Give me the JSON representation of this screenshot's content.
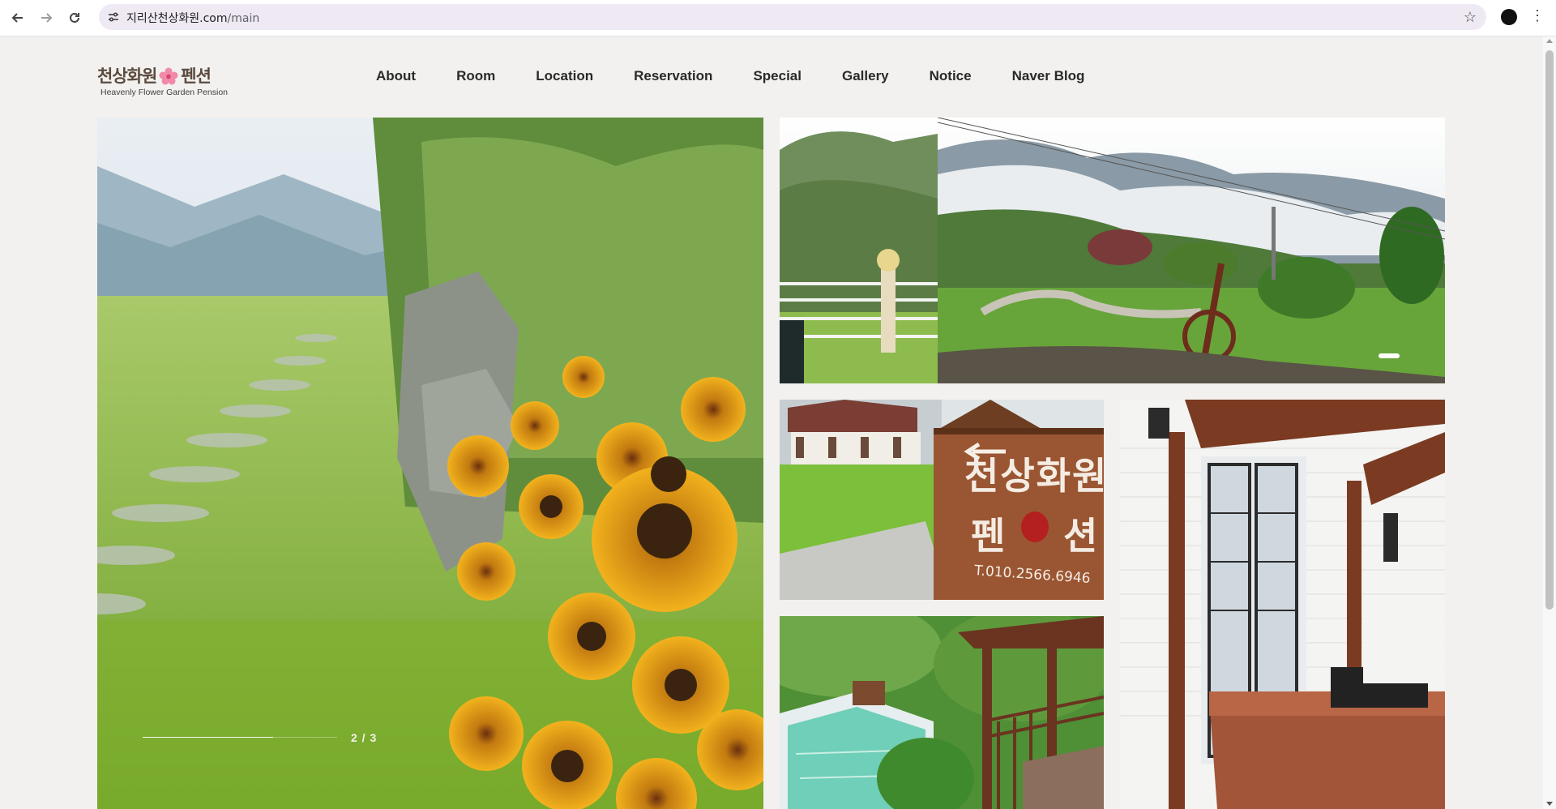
{
  "browser": {
    "url_host": "지리산천상화원.com",
    "url_path": "/main",
    "back_icon": "arrow-left-icon",
    "forward_icon": "arrow-right-icon",
    "reload_icon": "reload-icon",
    "bookmark_icon": "star-icon"
  },
  "site": {
    "logo_part1": "천상화원",
    "logo_part2": "펜션",
    "logo_tagline": "Heavenly Flower Garden Pension",
    "menu": [
      "About",
      "Room",
      "Location",
      "Reservation",
      "Special",
      "Gallery",
      "Notice",
      "Naver Blog"
    ]
  },
  "hero_slider": {
    "counter": "2 / 3",
    "current": 2,
    "total": 3
  },
  "gallery": {
    "sign_line1": "천상화원",
    "sign_line2_left": "펜",
    "sign_line2_right": "션",
    "sign_phone": "T.010.2566.6946"
  },
  "colors": {
    "page_bg": "#f2f1ef",
    "menu_text": "#2a2a2a",
    "logo_brown": "#5a4a3e"
  }
}
